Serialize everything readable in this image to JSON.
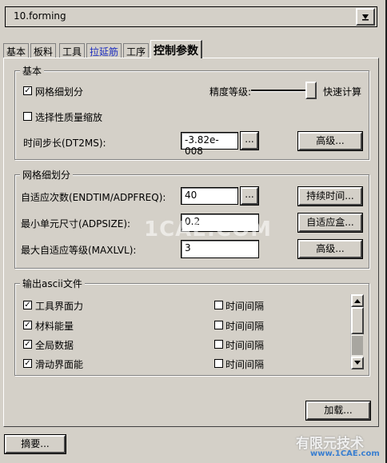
{
  "header": {
    "combo_value": "10.forming"
  },
  "tabs": [
    {
      "label": "基本"
    },
    {
      "label": "板料"
    },
    {
      "label": "工具"
    },
    {
      "label": "拉延筋"
    },
    {
      "label": "工序"
    },
    {
      "label": "控制参数"
    }
  ],
  "basic": {
    "title": "基本",
    "mesh_refine_label": "网格细划分",
    "precision_label": "精度等级:",
    "fast_calc_label": "快速计算",
    "selective_mass_label": "选择性质量缩放",
    "timestep_label": "时间步长(DT2MS):",
    "timestep_value": "-3.82e-008",
    "dots": "...",
    "advanced_button": "高级..."
  },
  "mesh": {
    "title": "网格细划分",
    "adapt_count_label": "自适应次数(ENDTIM/ADPFREQ):",
    "adapt_count_value": "40",
    "dots": "...",
    "duration_button": "持续时间...",
    "min_size_label": "最小单元尺寸(ADPSIZE):",
    "min_size_value": "0.2",
    "adapt_box_button": "自适应盒...",
    "max_level_label": "最大自适应等级(MAXLVL):",
    "max_level_value": "3",
    "advanced_button": "高级..."
  },
  "ascii": {
    "title": "输出ascii文件",
    "rows": [
      {
        "label": "工具界面力",
        "checked": true,
        "interval_label": "时间间隔"
      },
      {
        "label": "材料能量",
        "checked": true,
        "interval_label": "时间间隔"
      },
      {
        "label": "全局数据",
        "checked": true,
        "interval_label": "时间间隔"
      },
      {
        "label": "滑动界面能",
        "checked": true,
        "interval_label": "时间间隔"
      }
    ]
  },
  "footer": {
    "load_button": "加载...",
    "summary_button": "摘要..."
  },
  "watermark": {
    "center": "1CAE.COM",
    "corner_line1": "有限元技术",
    "corner_line2": "www.1CAE.com"
  }
}
